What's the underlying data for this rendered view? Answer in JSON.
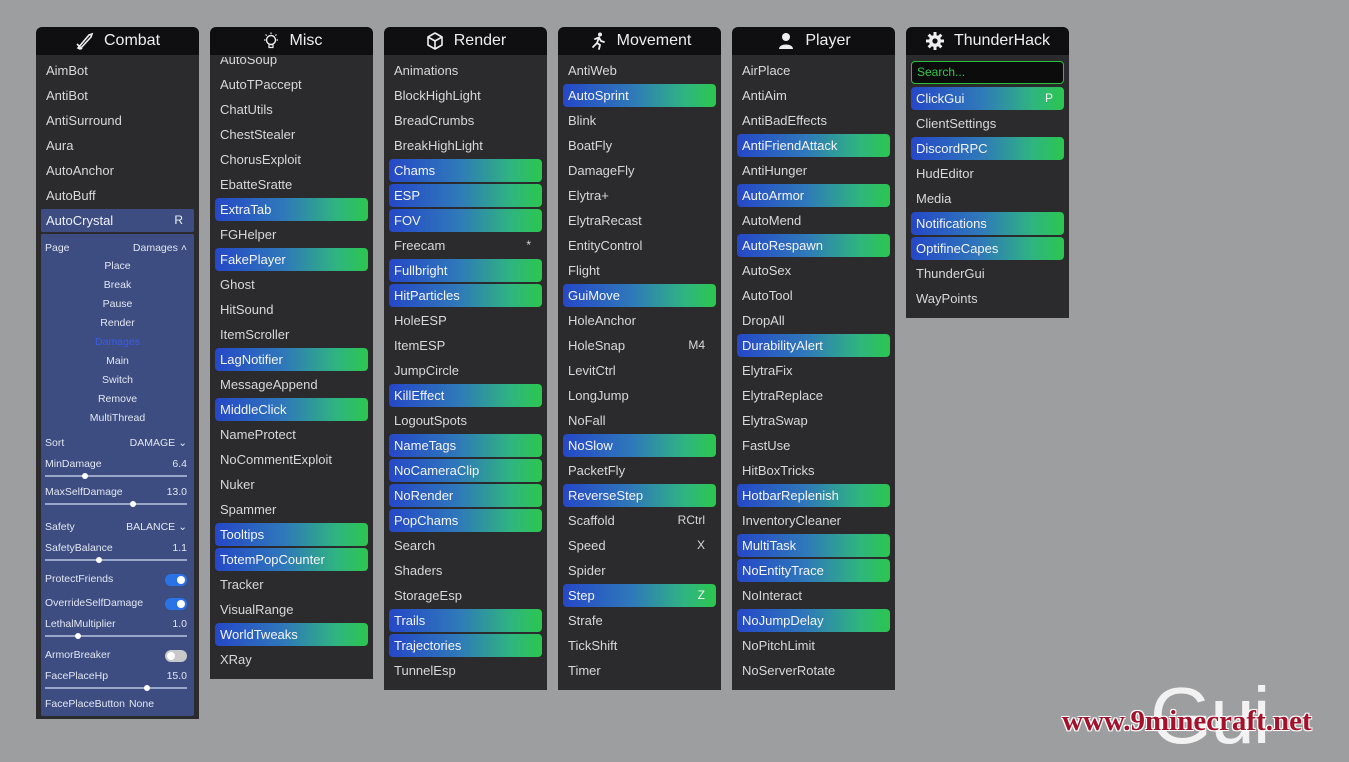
{
  "panels": [
    {
      "id": "combat",
      "title": "Combat",
      "icon": "sword-icon",
      "items": [
        {
          "label": "AimBot"
        },
        {
          "label": "AntiBot"
        },
        {
          "label": "AntiSurround"
        },
        {
          "label": "Aura"
        },
        {
          "label": "AutoAnchor"
        },
        {
          "label": "AutoBuff"
        }
      ],
      "expanded": {
        "label": "AutoCrystal",
        "key": "R",
        "page": {
          "label": "Page",
          "value": "Damages",
          "options": [
            "Place",
            "Break",
            "Pause",
            "Render",
            "Damages",
            "Main",
            "Switch",
            "Remove",
            "MultiThread"
          ]
        },
        "sort": {
          "label": "Sort",
          "value": "DAMAGE"
        },
        "min_damage": {
          "label": "MinDamage",
          "value": "6.4",
          "fraction": 0.28
        },
        "max_self_damage": {
          "label": "MaxSelfDamage",
          "value": "13.0",
          "fraction": 0.62
        },
        "safety": {
          "label": "Safety",
          "value": "BALANCE"
        },
        "safety_balance": {
          "label": "SafetyBalance",
          "value": "1.1",
          "fraction": 0.38
        },
        "protect_friends": {
          "label": "ProtectFriends",
          "on": true
        },
        "override_self_damage": {
          "label": "OverrideSelfDamage",
          "on": true
        },
        "lethal_multiplier": {
          "label": "LethalMultiplier",
          "value": "1.0",
          "fraction": 0.23
        },
        "armor_breaker": {
          "label": "ArmorBreaker",
          "on": false
        },
        "face_place_hp": {
          "label": "FacePlaceHp",
          "value": "15.0",
          "fraction": 0.72
        },
        "face_place_button": {
          "label": "FacePlaceButton",
          "value": "None"
        }
      }
    },
    {
      "id": "misc",
      "title": "Misc",
      "icon": "lightbulb-icon",
      "items": [
        {
          "label": "AutoSoup"
        },
        {
          "label": "AutoTPaccept"
        },
        {
          "label": "ChatUtils"
        },
        {
          "label": "ChestStealer"
        },
        {
          "label": "ChorusExploit"
        },
        {
          "label": "EbatteSratte"
        },
        {
          "label": "ExtraTab",
          "on": true
        },
        {
          "label": "FGHelper"
        },
        {
          "label": "FakePlayer",
          "on": true
        },
        {
          "label": "Ghost"
        },
        {
          "label": "HitSound"
        },
        {
          "label": "ItemScroller"
        },
        {
          "label": "LagNotifier",
          "on": true
        },
        {
          "label": "MessageAppend"
        },
        {
          "label": "MiddleClick",
          "on": true
        },
        {
          "label": "NameProtect"
        },
        {
          "label": "NoCommentExploit"
        },
        {
          "label": "Nuker"
        },
        {
          "label": "Spammer"
        },
        {
          "label": "Tooltips",
          "on": true
        },
        {
          "label": "TotemPopCounter",
          "on": true
        },
        {
          "label": "Tracker"
        },
        {
          "label": "VisualRange"
        },
        {
          "label": "WorldTweaks",
          "on": true
        },
        {
          "label": "XRay"
        }
      ]
    },
    {
      "id": "render",
      "title": "Render",
      "icon": "cube-icon",
      "items": [
        {
          "label": "Animations"
        },
        {
          "label": "BlockHighLight"
        },
        {
          "label": "BreadCrumbs"
        },
        {
          "label": "BreakHighLight"
        },
        {
          "label": "Chams",
          "on": true
        },
        {
          "label": "ESP",
          "on": true
        },
        {
          "label": "FOV",
          "on": true
        },
        {
          "label": "Freecam",
          "key": "*"
        },
        {
          "label": "Fullbright",
          "on": true
        },
        {
          "label": "HitParticles",
          "on": true
        },
        {
          "label": "HoleESP"
        },
        {
          "label": "ItemESP"
        },
        {
          "label": "JumpCircle"
        },
        {
          "label": "KillEffect",
          "on": true
        },
        {
          "label": "LogoutSpots"
        },
        {
          "label": "NameTags",
          "on": true
        },
        {
          "label": "NoCameraClip",
          "on": true
        },
        {
          "label": "NoRender",
          "on": true
        },
        {
          "label": "PopChams",
          "on": true
        },
        {
          "label": "Search"
        },
        {
          "label": "Shaders"
        },
        {
          "label": "StorageEsp"
        },
        {
          "label": "Trails",
          "on": true
        },
        {
          "label": "Trajectories",
          "on": true
        },
        {
          "label": "TunnelEsp"
        }
      ]
    },
    {
      "id": "movement",
      "title": "Movement",
      "icon": "running-person-icon",
      "items": [
        {
          "label": "AntiWeb"
        },
        {
          "label": "AutoSprint",
          "on": true
        },
        {
          "label": "Blink"
        },
        {
          "label": "BoatFly"
        },
        {
          "label": "DamageFly"
        },
        {
          "label": "Elytra+"
        },
        {
          "label": "ElytraRecast"
        },
        {
          "label": "EntityControl"
        },
        {
          "label": "Flight"
        },
        {
          "label": "GuiMove",
          "on": true
        },
        {
          "label": "HoleAnchor"
        },
        {
          "label": "HoleSnap",
          "key": "M4"
        },
        {
          "label": "LevitCtrl"
        },
        {
          "label": "LongJump"
        },
        {
          "label": "NoFall"
        },
        {
          "label": "NoSlow",
          "on": true
        },
        {
          "label": "PacketFly"
        },
        {
          "label": "ReverseStep",
          "on": true
        },
        {
          "label": "Scaffold",
          "key": "RCtrl"
        },
        {
          "label": "Speed",
          "key": "X"
        },
        {
          "label": "Spider"
        },
        {
          "label": "Step",
          "on": true,
          "key": "Z"
        },
        {
          "label": "Strafe"
        },
        {
          "label": "TickShift"
        },
        {
          "label": "Timer"
        }
      ]
    },
    {
      "id": "player",
      "title": "Player",
      "icon": "user-icon",
      "items": [
        {
          "label": "AirPlace"
        },
        {
          "label": "AntiAim"
        },
        {
          "label": "AntiBadEffects"
        },
        {
          "label": "AntiFriendAttack",
          "on": true
        },
        {
          "label": "AntiHunger"
        },
        {
          "label": "AutoArmor",
          "on": true
        },
        {
          "label": "AutoMend"
        },
        {
          "label": "AutoRespawn",
          "on": true
        },
        {
          "label": "AutoSex"
        },
        {
          "label": "AutoTool"
        },
        {
          "label": "DropAll"
        },
        {
          "label": "DurabilityAlert",
          "on": true
        },
        {
          "label": "ElytraFix"
        },
        {
          "label": "ElytraReplace"
        },
        {
          "label": "ElytraSwap"
        },
        {
          "label": "FastUse"
        },
        {
          "label": "HitBoxTricks"
        },
        {
          "label": "HotbarReplenish",
          "on": true
        },
        {
          "label": "InventoryCleaner"
        },
        {
          "label": "MultiTask",
          "on": true
        },
        {
          "label": "NoEntityTrace",
          "on": true
        },
        {
          "label": "NoInteract"
        },
        {
          "label": "NoJumpDelay",
          "on": true
        },
        {
          "label": "NoPitchLimit"
        },
        {
          "label": "NoServerRotate"
        }
      ]
    },
    {
      "id": "thunderhack",
      "title": "ThunderHack",
      "icon": "gear-icon",
      "search_placeholder": "Search...",
      "items": [
        {
          "label": "ClickGui",
          "on": true,
          "key": "P"
        },
        {
          "label": "ClientSettings"
        },
        {
          "label": "DiscordRPC",
          "on": true
        },
        {
          "label": "HudEditor"
        },
        {
          "label": "Media"
        },
        {
          "label": "Notifications",
          "on": true
        },
        {
          "label": "OptifineCapes",
          "on": true
        },
        {
          "label": "ThunderGui"
        },
        {
          "label": "WayPoints"
        }
      ]
    }
  ],
  "watermark": {
    "big": "Gui",
    "site": "www.9minecraft.net"
  },
  "colors": {
    "background": "#9c9ea0",
    "panel": "#2b2b2d",
    "header": "#0f0f11",
    "accent_start": "#2548c8",
    "accent_end": "#2cc64e",
    "settings_bg": "#3d4d82",
    "selected_page": "#3a5ce8",
    "search_border": "#29c03a"
  }
}
